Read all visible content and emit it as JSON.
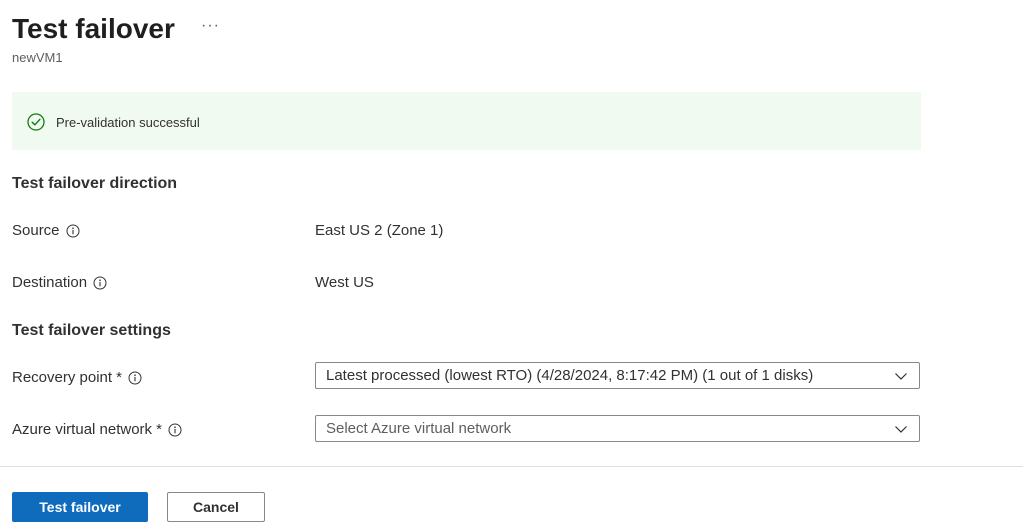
{
  "header": {
    "title": "Test failover",
    "more_glyph": "···",
    "subtitle": "newVM1"
  },
  "banner": {
    "message": "Pre-validation successful",
    "icon": "success-check-icon",
    "accent_color": "#107c10"
  },
  "direction": {
    "heading": "Test failover direction",
    "source_label": "Source",
    "source_value": "East US 2 (Zone 1)",
    "destination_label": "Destination",
    "destination_value": "West US"
  },
  "settings": {
    "heading": "Test failover settings",
    "recovery_point_label": "Recovery point",
    "recovery_point_value": "Latest processed (lowest RTO) (4/28/2024, 8:17:42 PM) (1 out of 1 disks)",
    "vnet_label": "Azure virtual network",
    "vnet_placeholder": "Select Azure virtual network",
    "required_marker": "*"
  },
  "footer": {
    "primary_label": "Test failover",
    "cancel_label": "Cancel",
    "primary_color": "#0f6cbd"
  }
}
